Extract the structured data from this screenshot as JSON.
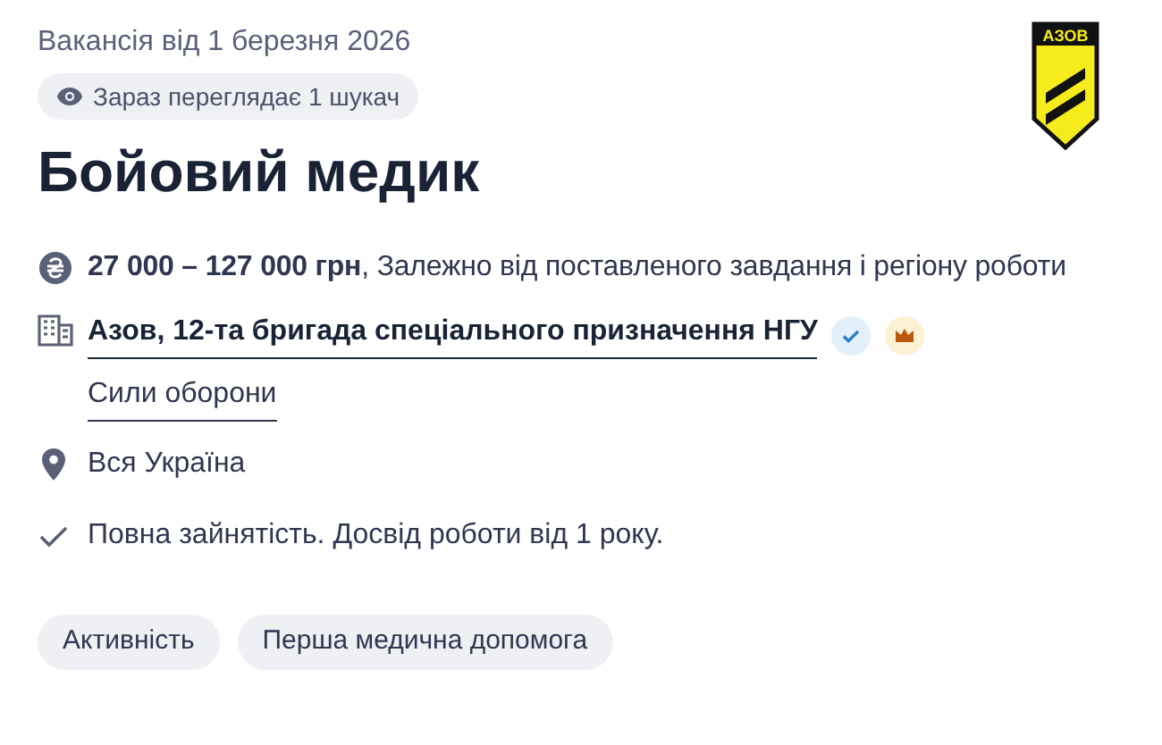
{
  "posted": "Вакансія від 1 березня 2026",
  "viewers_badge": "Зараз переглядає 1 шукач",
  "logo_text": "АЗОВ",
  "title": "Бойовий медик",
  "salary": "**27 000 – 127 000 грн**, Залежно від поставленого завдання і регіону роботи",
  "company": {
    "name": "Азов, 12-та бригада спеціального призначення НГУ",
    "category": "Сили оборони"
  },
  "location": "Вся Україна",
  "conditions": "Повна зайнятість. Досвід роботи від 1 року.",
  "tags": [
    {
      "label": "Активність"
    },
    {
      "label": "Перша медична допомога"
    }
  ]
}
